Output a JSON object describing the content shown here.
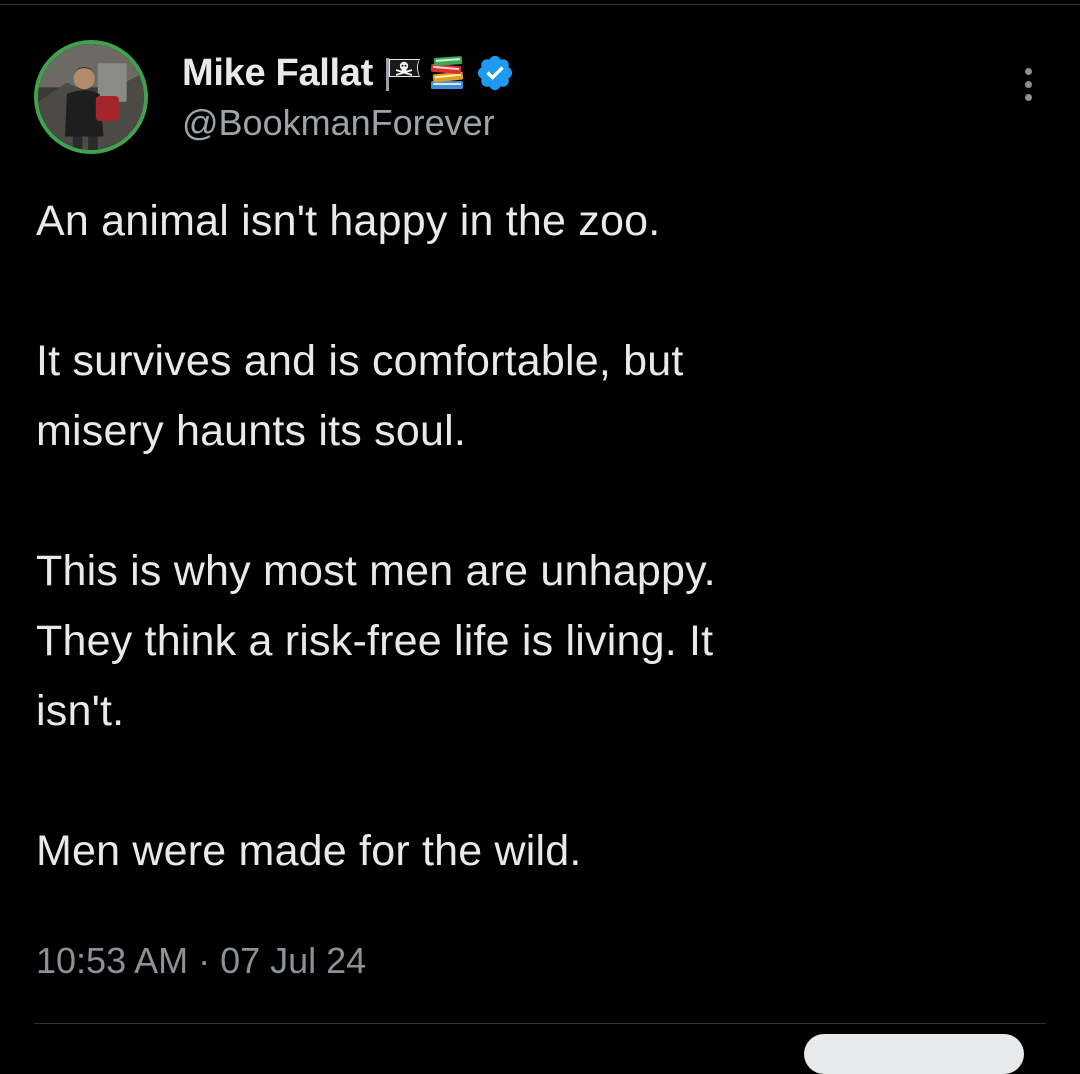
{
  "author": {
    "display_name": "Mike Fallat",
    "handle": "@BookmanForever",
    "badge_emojis": [
      "pirate-flag",
      "books"
    ],
    "verified": true
  },
  "tweet": {
    "paragraphs": [
      "An animal isn't happy in the zoo.",
      "It survives and is comfortable, but\nmisery haunts its soul.",
      "This is why most men are unhappy.\nThey think a risk-free life is living.  It\nisn't.",
      "Men were made for the wild."
    ],
    "timestamp": "10:53 AM · 07 Jul 24"
  },
  "icons": {
    "more": "more-vertical-icon",
    "verified": "verified-badge-icon"
  },
  "colors": {
    "background": "#000000",
    "text_primary": "#e7e9ea",
    "text_secondary": "#8b9196",
    "verified_blue": "#1d9bf0",
    "avatar_ring": "#3fa34d",
    "divider": "#2f3336"
  }
}
